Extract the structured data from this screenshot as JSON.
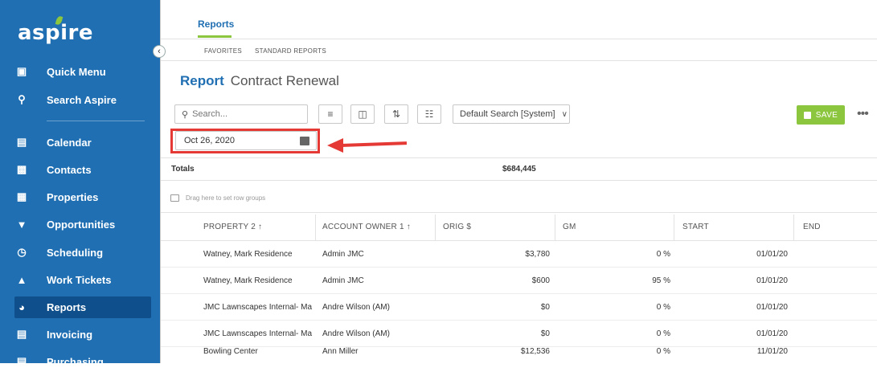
{
  "sidebar": {
    "logo": "aspire",
    "items": [
      {
        "label": "Quick Menu",
        "icon": "quick-menu-icon"
      },
      {
        "label": "Search Aspire",
        "icon": "search-icon"
      },
      {
        "label": "Calendar",
        "icon": "calendar-icon"
      },
      {
        "label": "Contacts",
        "icon": "contacts-icon"
      },
      {
        "label": "Properties",
        "icon": "properties-icon"
      },
      {
        "label": "Opportunities",
        "icon": "trophy-icon"
      },
      {
        "label": "Scheduling",
        "icon": "scheduling-icon"
      },
      {
        "label": "Work Tickets",
        "icon": "clipboard-icon"
      },
      {
        "label": "Reports",
        "icon": "pie-chart-icon",
        "active": true
      },
      {
        "label": "Invoicing",
        "icon": "invoice-icon"
      },
      {
        "label": "Purchasing",
        "icon": "purchasing-icon"
      }
    ],
    "colors": {
      "background": "#1f6fb2",
      "active": "#0f4f8c",
      "accent": "#8cc63f"
    }
  },
  "header": {
    "tab": "Reports",
    "subtabs": [
      "FAVORITES",
      "STANDARD REPORTS"
    ]
  },
  "title": {
    "prefix": "Report",
    "name": "Contract Renewal"
  },
  "toolbar": {
    "search_placeholder": "Search...",
    "view_select": "Default Search [System]",
    "save_label": "SAVE"
  },
  "date_filter": {
    "value": "Oct 26, 2020"
  },
  "totals": {
    "label": "Totals",
    "value": "$684,445"
  },
  "groups_hint": "Drag here to set row groups",
  "table": {
    "columns": [
      "PROPERTY 2 ↑",
      "ACCOUNT OWNER 1 ↑",
      "ORIG $",
      "GM",
      "START",
      "END"
    ],
    "rows": [
      [
        "Watney, Mark Residence",
        "Admin JMC",
        "$3,780",
        "0 %",
        "01/01/20"
      ],
      [
        "Watney, Mark Residence",
        "Admin JMC",
        "$600",
        "95 %",
        "01/01/20"
      ],
      [
        "JMC Lawnscapes Internal- Ma",
        "Andre Wilson (AM)",
        "$0",
        "0 %",
        "01/01/20"
      ],
      [
        "JMC Lawnscapes Internal- Ma",
        "Andre Wilson (AM)",
        "$0",
        "0 %",
        "01/01/20"
      ],
      [
        "Bowling Center",
        "Ann Miller",
        "$12,536",
        "0 %",
        "11/01/20"
      ]
    ]
  }
}
